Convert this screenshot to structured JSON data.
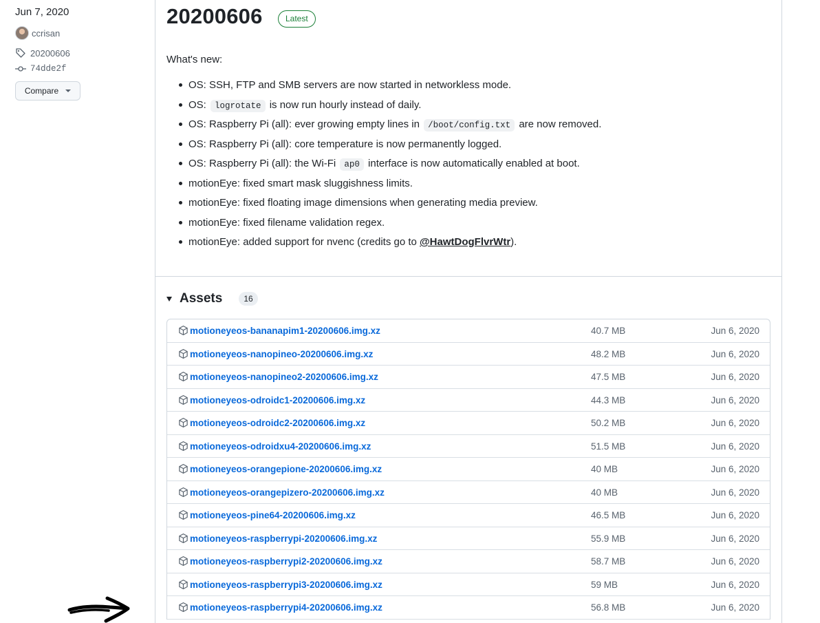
{
  "sidebar": {
    "date": "Jun 7, 2020",
    "author": "ccrisan",
    "tag": "20200606",
    "commit": "74dde2f",
    "compare_label": "Compare"
  },
  "release": {
    "title": "20200606",
    "badge": "Latest",
    "intro": "What's new:",
    "items": [
      {
        "parts": [
          {
            "t": "text",
            "v": "OS: SSH, FTP and SMB servers are now started in networkless mode."
          }
        ]
      },
      {
        "parts": [
          {
            "t": "text",
            "v": "OS: "
          },
          {
            "t": "code",
            "v": "logrotate"
          },
          {
            "t": "text",
            "v": " is now run hourly instead of daily."
          }
        ]
      },
      {
        "parts": [
          {
            "t": "text",
            "v": "OS: Raspberry Pi (all): ever growing empty lines in "
          },
          {
            "t": "code",
            "v": "/boot/config.txt"
          },
          {
            "t": "text",
            "v": " are now removed."
          }
        ]
      },
      {
        "parts": [
          {
            "t": "text",
            "v": "OS: Raspberry Pi (all): core temperature is now permanently logged."
          }
        ]
      },
      {
        "parts": [
          {
            "t": "text",
            "v": "OS: Raspberry Pi (all): the Wi-Fi "
          },
          {
            "t": "code",
            "v": "ap0"
          },
          {
            "t": "text",
            "v": " interface is now automatically enabled at boot."
          }
        ]
      },
      {
        "parts": [
          {
            "t": "text",
            "v": "motionEye: fixed smart mask sluggishness limits."
          }
        ]
      },
      {
        "parts": [
          {
            "t": "text",
            "v": "motionEye: fixed floating image dimensions when generating media preview."
          }
        ]
      },
      {
        "parts": [
          {
            "t": "text",
            "v": "motionEye: fixed filename validation regex."
          }
        ]
      },
      {
        "parts": [
          {
            "t": "text",
            "v": "motionEye: added support for nvenc (credits go to "
          },
          {
            "t": "mention",
            "v": "@HawtDogFlvrWtr"
          },
          {
            "t": "text",
            "v": ")."
          }
        ]
      }
    ]
  },
  "assets": {
    "label": "Assets",
    "count": "16",
    "rows": [
      {
        "name": "motioneyeos-bananapim1-20200606.img.xz",
        "size": "40.7 MB",
        "date": "Jun 6, 2020"
      },
      {
        "name": "motioneyeos-nanopineo-20200606.img.xz",
        "size": "48.2 MB",
        "date": "Jun 6, 2020"
      },
      {
        "name": "motioneyeos-nanopineo2-20200606.img.xz",
        "size": "47.5 MB",
        "date": "Jun 6, 2020"
      },
      {
        "name": "motioneyeos-odroidc1-20200606.img.xz",
        "size": "44.3 MB",
        "date": "Jun 6, 2020"
      },
      {
        "name": "motioneyeos-odroidc2-20200606.img.xz",
        "size": "50.2 MB",
        "date": "Jun 6, 2020"
      },
      {
        "name": "motioneyeos-odroidxu4-20200606.img.xz",
        "size": "51.5 MB",
        "date": "Jun 6, 2020"
      },
      {
        "name": "motioneyeos-orangepione-20200606.img.xz",
        "size": "40 MB",
        "date": "Jun 6, 2020"
      },
      {
        "name": "motioneyeos-orangepizero-20200606.img.xz",
        "size": "40 MB",
        "date": "Jun 6, 2020"
      },
      {
        "name": "motioneyeos-pine64-20200606.img.xz",
        "size": "46.5 MB",
        "date": "Jun 6, 2020"
      },
      {
        "name": "motioneyeos-raspberrypi-20200606.img.xz",
        "size": "55.9 MB",
        "date": "Jun 6, 2020"
      },
      {
        "name": "motioneyeos-raspberrypi2-20200606.img.xz",
        "size": "58.7 MB",
        "date": "Jun 6, 2020"
      },
      {
        "name": "motioneyeos-raspberrypi3-20200606.img.xz",
        "size": "59 MB",
        "date": "Jun 6, 2020"
      },
      {
        "name": "motioneyeos-raspberrypi4-20200606.img.xz",
        "size": "56.8 MB",
        "date": "Jun 6, 2020"
      }
    ]
  },
  "colors": {
    "link": "#0969da",
    "latest_badge": "#1a7f37",
    "muted_text": "#59636e",
    "border": "#d0d7de"
  }
}
